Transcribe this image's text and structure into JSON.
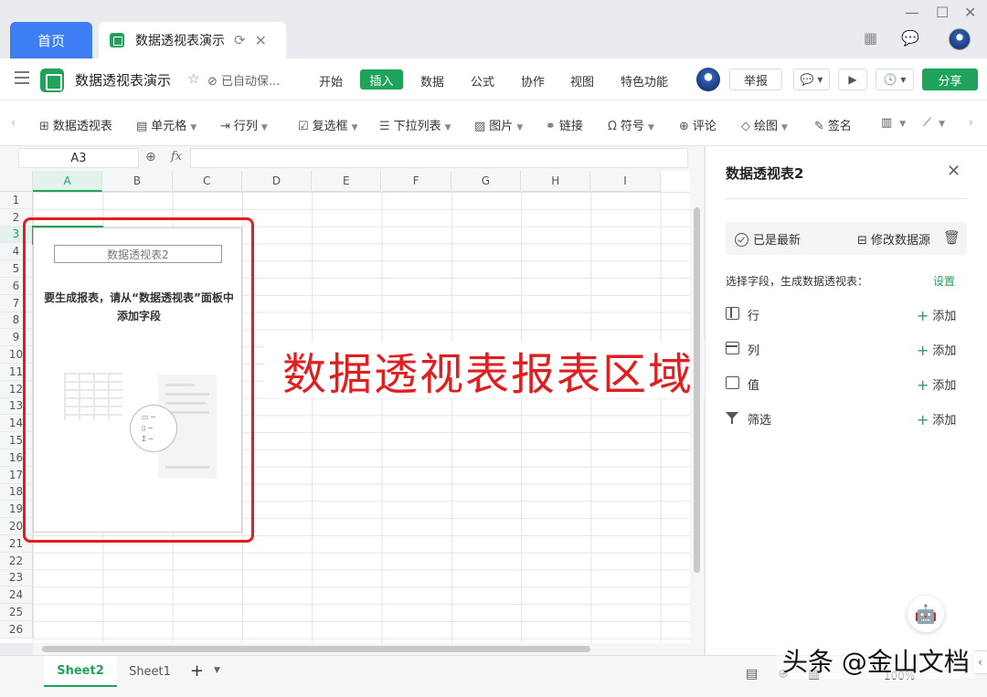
{
  "titlebar": {
    "home_tab": "首页",
    "doc_tab": "数据透视表演示",
    "icons": [
      "refresh-icon",
      "close-icon",
      "grid-apps-icon",
      "chat-icon",
      "avatar"
    ]
  },
  "menubar": {
    "doc_title": "数据透视表演示",
    "saved_status": "已自动保...",
    "items": [
      "开始",
      "插入",
      "数据",
      "公式",
      "协作",
      "视图",
      "特色功能"
    ],
    "active_item": "插入",
    "report_label": "举报",
    "share_label": "分享"
  },
  "toolbar": {
    "items": [
      {
        "label": "数据透视表",
        "icon": "pivot-icon",
        "dropdown": false
      },
      {
        "label": "单元格",
        "icon": "cell-icon",
        "dropdown": true
      },
      {
        "label": "行列",
        "icon": "rowcol-icon",
        "dropdown": true
      },
      {
        "label": "复选框",
        "icon": "checkbox-icon",
        "dropdown": true
      },
      {
        "label": "下拉列表",
        "icon": "dropdown-list-icon",
        "dropdown": true
      },
      {
        "label": "图片",
        "icon": "image-icon",
        "dropdown": true
      },
      {
        "label": "链接",
        "icon": "link-icon",
        "dropdown": false
      },
      {
        "label": "符号",
        "icon": "omega-icon",
        "dropdown": true
      },
      {
        "label": "评论",
        "icon": "comment-icon",
        "dropdown": false
      },
      {
        "label": "绘图",
        "icon": "draw-icon",
        "dropdown": true
      },
      {
        "label": "签名",
        "icon": "sign-icon",
        "dropdown": false
      }
    ]
  },
  "formula": {
    "cell_ref": "A3",
    "fx": "fx",
    "value": ""
  },
  "grid": {
    "columns": [
      "A",
      "B",
      "C",
      "D",
      "E",
      "F",
      "G",
      "H",
      "I"
    ],
    "rows": [
      "1",
      "2",
      "3",
      "4",
      "5",
      "6",
      "7",
      "8",
      "9",
      "10",
      "11",
      "12",
      "13",
      "14",
      "15",
      "16",
      "17",
      "18",
      "19",
      "20",
      "21",
      "22",
      "23",
      "24",
      "25",
      "26"
    ],
    "selected_cell": "A3"
  },
  "pivot": {
    "title": "数据透视表2",
    "hint": "要生成报表，请从“数据透视表”面板中添加字段",
    "overlay_caption": "数据透视表报表区域"
  },
  "panel": {
    "title": "数据透视表2",
    "status": "已是最新",
    "modify_source": "修改数据源",
    "choose_label": "选择字段，生成数据透视表：",
    "settings_label": "设置",
    "fields": [
      {
        "label": "行",
        "add": "添加"
      },
      {
        "label": "列",
        "add": "添加"
      },
      {
        "label": "值",
        "add": "添加"
      },
      {
        "label": "筛选",
        "add": "添加"
      }
    ]
  },
  "sheets": {
    "tabs": [
      "Sheet2",
      "Sheet1"
    ],
    "active": "Sheet2",
    "zoom": "100%"
  },
  "watermark": "头条 @金山文档",
  "colors": {
    "accent_green": "#1fa35a",
    "home_blue": "#3d7ef5",
    "annotation_red": "#e02020"
  }
}
